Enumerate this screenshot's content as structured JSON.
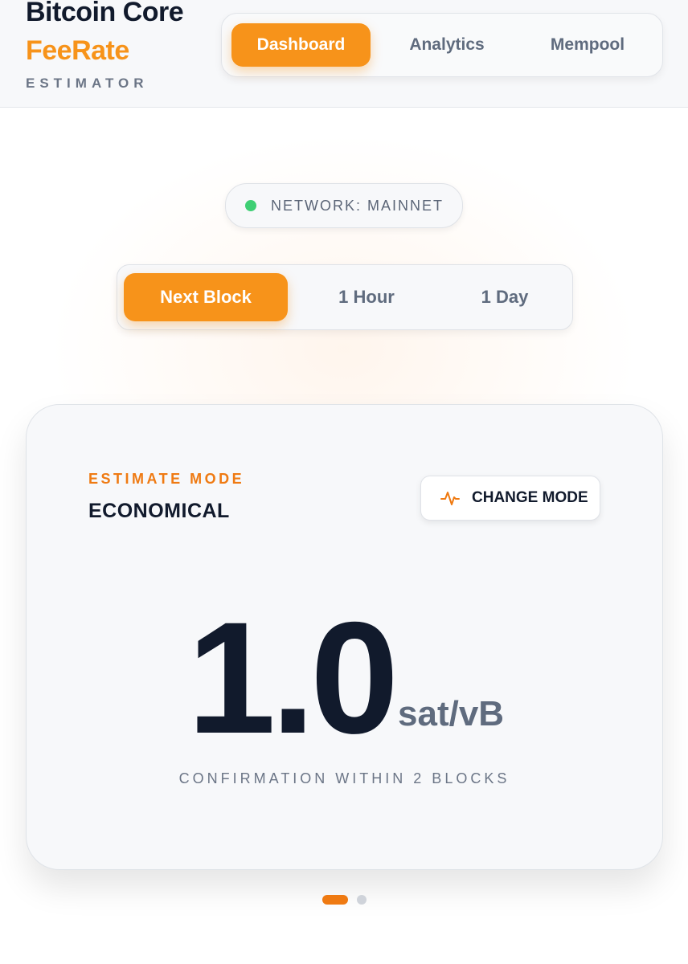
{
  "header": {
    "brand_line1": "Bitcoin Core",
    "brand_line2": "FeeRate",
    "brand_line3": "ESTIMATOR",
    "nav": [
      {
        "label": "Dashboard",
        "active": true
      },
      {
        "label": "Analytics",
        "active": false
      },
      {
        "label": "Mempool",
        "active": false
      }
    ]
  },
  "network": {
    "label": "NETWORK: MAINNET",
    "status_color": "#3fcf74"
  },
  "horizon": [
    {
      "label": "Next Block",
      "active": true
    },
    {
      "label": "1 Hour",
      "active": false
    },
    {
      "label": "1 Day",
      "active": false
    }
  ],
  "card": {
    "mode_label": "ESTIMATE MODE",
    "mode_value": "ECONOMICAL",
    "change_button": "CHANGE MODE",
    "change_icon": "activity-pulse-icon",
    "fee_value": "1.0",
    "fee_unit": "sat/vB",
    "confirmation": "CONFIRMATION WITHIN 2 BLOCKS"
  },
  "pager": {
    "count": 2,
    "active_index": 0
  },
  "colors": {
    "accent": "#f7931a",
    "accent_dark": "#ef7a12",
    "text_dark": "#111a2c",
    "text_muted": "#5f6b7e"
  }
}
